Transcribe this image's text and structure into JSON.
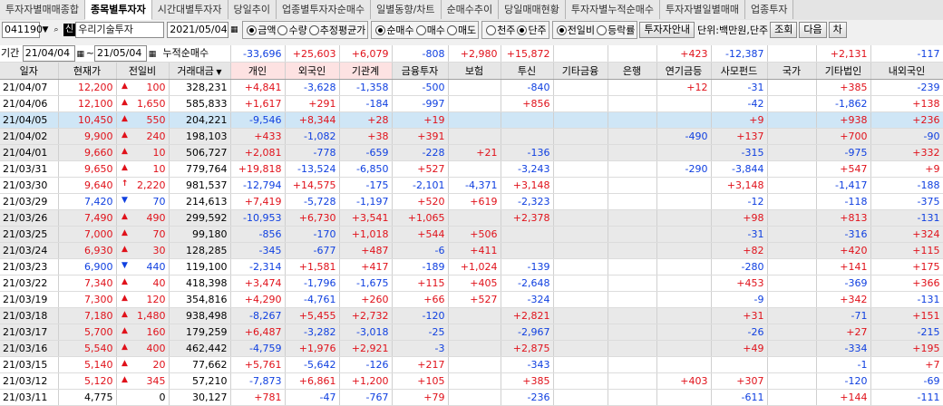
{
  "tabs": [
    "투자자별매매종합",
    "종목별투자자",
    "시간대별투자자",
    "당일추이",
    "업종별투자자순매수",
    "일별동향/차트",
    "순매수추이",
    "당일매매현황",
    "투자자별누적순매수",
    "투자자별일별매매",
    "업종투자"
  ],
  "active_tab": 1,
  "toolbar": {
    "code": "041190",
    "shin": "신",
    "stock_name": "우리기술투자",
    "date": "2021/05/04",
    "radio_amount": "금액",
    "radio_qty": "수량",
    "radio_avg": "추정평균가",
    "radio_net": "순매수",
    "radio_buy": "매수",
    "radio_sell": "매도",
    "radio_thousand": "천주",
    "radio_unit": "단주",
    "radio_prevday": "전일비",
    "radio_rate": "등락률",
    "guide_btn": "투자자안내",
    "unit_text": "단위:백만원,단주",
    "search_btn": "조회",
    "next_btn": "다음",
    "chart_btn": "차"
  },
  "period": {
    "label": "기간",
    "from": "21/04/04",
    "tilde": "~",
    "to": "21/05/04",
    "cum_label": "누적순매수",
    "sums": [
      "-33,696",
      "+25,603",
      "+6,079",
      "-808",
      "+2,980",
      "+15,872",
      "",
      "",
      "+423",
      "-12,387",
      "",
      "+2,131",
      "-117"
    ]
  },
  "headers": [
    "일자",
    "현재가",
    "전일비",
    "거래대금",
    "개인",
    "외국인",
    "기관계",
    "금융투자",
    "보험",
    "투신",
    "기타금융",
    "은행",
    "연기금등",
    "사모펀드",
    "국가",
    "기타법인",
    "내외국인"
  ],
  "rows": [
    {
      "d": "21/04/07",
      "p": "12,200",
      "dir": "up",
      "c": "100",
      "v": "328,231",
      "vals": [
        "+4,841",
        "-3,628",
        "-1,358",
        "-500",
        "",
        "-840",
        "",
        "",
        "+12",
        "-31",
        "",
        "+385",
        "-239"
      ]
    },
    {
      "d": "21/04/06",
      "p": "12,100",
      "dir": "up",
      "c": "1,650",
      "v": "585,833",
      "vals": [
        "+1,617",
        "+291",
        "-184",
        "-997",
        "",
        "+856",
        "",
        "",
        "",
        "-42",
        "",
        "-1,862",
        "+138"
      ]
    },
    {
      "d": "21/04/05",
      "p": "10,450",
      "dir": "up",
      "c": "550",
      "v": "204,221",
      "vals": [
        "-9,546",
        "+8,344",
        "+28",
        "+19",
        "",
        "",
        "",
        "",
        "",
        "+9",
        "",
        "+938",
        "+236"
      ]
    },
    {
      "d": "21/04/02",
      "p": "9,900",
      "dir": "up",
      "c": "240",
      "v": "198,103",
      "vals": [
        "+433",
        "-1,082",
        "+38",
        "+391",
        "",
        "",
        "",
        "",
        "-490",
        "+137",
        "",
        "+700",
        "-90"
      ]
    },
    {
      "d": "21/04/01",
      "p": "9,660",
      "dir": "up",
      "c": "10",
      "v": "506,727",
      "vals": [
        "+2,081",
        "-778",
        "-659",
        "-228",
        "+21",
        "-136",
        "",
        "",
        "",
        "-315",
        "",
        "-975",
        "+332"
      ]
    },
    {
      "d": "21/03/31",
      "p": "9,650",
      "dir": "up",
      "c": "10",
      "v": "779,764",
      "vals": [
        "+19,818",
        "-13,524",
        "-6,850",
        "+527",
        "",
        "-3,243",
        "",
        "",
        "-290",
        "-3,844",
        "",
        "+547",
        "+9"
      ]
    },
    {
      "d": "21/03/30",
      "p": "9,640",
      "dir": "upper",
      "c": "2,220",
      "v": "981,537",
      "vals": [
        "-12,794",
        "+14,575",
        "-175",
        "-2,101",
        "-4,371",
        "+3,148",
        "",
        "",
        "",
        "+3,148",
        "",
        "-1,417",
        "-188"
      ]
    },
    {
      "d": "21/03/29",
      "p": "7,420",
      "dir": "dn",
      "c": "70",
      "v": "214,613",
      "vals": [
        "+7,419",
        "-5,728",
        "-1,197",
        "+520",
        "+619",
        "-2,323",
        "",
        "",
        "",
        "-12",
        "",
        "-118",
        "-375"
      ]
    },
    {
      "d": "21/03/26",
      "p": "7,490",
      "dir": "up",
      "c": "490",
      "v": "299,592",
      "vals": [
        "-10,953",
        "+6,730",
        "+3,541",
        "+1,065",
        "",
        "+2,378",
        "",
        "",
        "",
        "+98",
        "",
        "+813",
        "-131"
      ]
    },
    {
      "d": "21/03/25",
      "p": "7,000",
      "dir": "up",
      "c": "70",
      "v": "99,180",
      "vals": [
        "-856",
        "-170",
        "+1,018",
        "+544",
        "+506",
        "",
        "",
        "",
        "",
        "-31",
        "",
        "-316",
        "+324"
      ]
    },
    {
      "d": "21/03/24",
      "p": "6,930",
      "dir": "up",
      "c": "30",
      "v": "128,285",
      "vals": [
        "-345",
        "-677",
        "+487",
        "-6",
        "+411",
        "",
        "",
        "",
        "",
        "+82",
        "",
        "+420",
        "+115"
      ]
    },
    {
      "d": "21/03/23",
      "p": "6,900",
      "dir": "dn",
      "c": "440",
      "v": "119,100",
      "vals": [
        "-2,314",
        "+1,581",
        "+417",
        "-189",
        "+1,024",
        "-139",
        "",
        "",
        "",
        "-280",
        "",
        "+141",
        "+175"
      ]
    },
    {
      "d": "21/03/22",
      "p": "7,340",
      "dir": "up",
      "c": "40",
      "v": "418,398",
      "vals": [
        "+3,474",
        "-1,796",
        "-1,675",
        "+115",
        "+405",
        "-2,648",
        "",
        "",
        "",
        "+453",
        "",
        "-369",
        "+366"
      ]
    },
    {
      "d": "21/03/19",
      "p": "7,300",
      "dir": "up",
      "c": "120",
      "v": "354,816",
      "vals": [
        "+4,290",
        "-4,761",
        "+260",
        "+66",
        "+527",
        "-324",
        "",
        "",
        "",
        "-9",
        "",
        "+342",
        "-131"
      ]
    },
    {
      "d": "21/03/18",
      "p": "7,180",
      "dir": "up",
      "c": "1,480",
      "v": "938,498",
      "vals": [
        "-8,267",
        "+5,455",
        "+2,732",
        "-120",
        "",
        "+2,821",
        "",
        "",
        "",
        "+31",
        "",
        "-71",
        "+151"
      ]
    },
    {
      "d": "21/03/17",
      "p": "5,700",
      "dir": "up",
      "c": "160",
      "v": "179,259",
      "vals": [
        "+6,487",
        "-3,282",
        "-3,018",
        "-25",
        "",
        "-2,967",
        "",
        "",
        "",
        "-26",
        "",
        "+27",
        "-215"
      ]
    },
    {
      "d": "21/03/16",
      "p": "5,540",
      "dir": "up",
      "c": "400",
      "v": "462,442",
      "vals": [
        "-4,759",
        "+1,976",
        "+2,921",
        "-3",
        "",
        "+2,875",
        "",
        "",
        "",
        "+49",
        "",
        "-334",
        "+195"
      ]
    },
    {
      "d": "21/03/15",
      "p": "5,140",
      "dir": "up",
      "c": "20",
      "v": "77,662",
      "vals": [
        "+5,761",
        "-5,642",
        "-126",
        "+217",
        "",
        "-343",
        "",
        "",
        "",
        "",
        "",
        "-1",
        "+7"
      ]
    },
    {
      "d": "21/03/12",
      "p": "5,120",
      "dir": "up",
      "c": "345",
      "v": "57,210",
      "vals": [
        "-7,873",
        "+6,861",
        "+1,200",
        "+105",
        "",
        "+385",
        "",
        "",
        "+403",
        "+307",
        "",
        "-120",
        "-69"
      ]
    },
    {
      "d": "21/03/11",
      "p": "4,775",
      "dir": "flat",
      "c": "0",
      "v": "30,127",
      "vals": [
        "+781",
        "-47",
        "-767",
        "+79",
        "",
        "-236",
        "",
        "",
        "",
        "-611",
        "",
        "+144",
        "-111"
      ]
    }
  ],
  "colors": {
    "up": "#e0111a",
    "down": "#1040e0",
    "selected": "#cfe6f6",
    "zebra": "#e9e9e9"
  }
}
